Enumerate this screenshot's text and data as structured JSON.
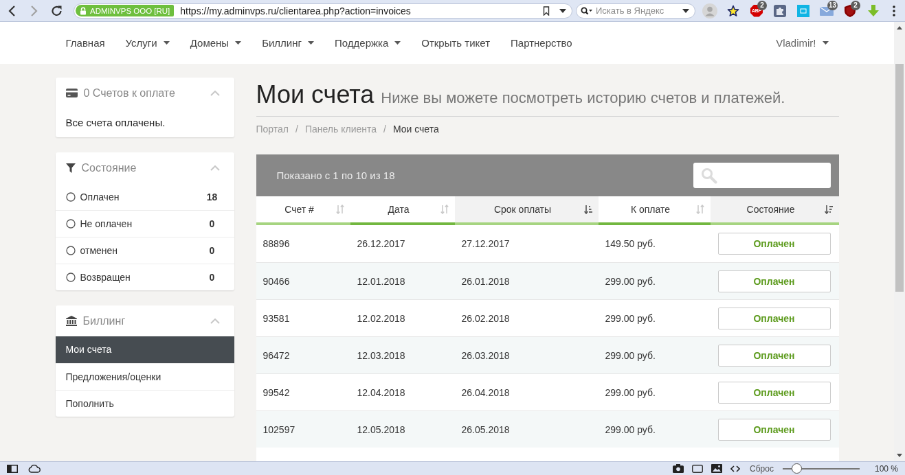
{
  "browser": {
    "nav_buttons": [
      {
        "kind": "back",
        "disabled": false
      },
      {
        "kind": "forward",
        "disabled": true
      },
      {
        "kind": "reload",
        "disabled": false
      }
    ],
    "address_bar": {
      "site_badge": "ADMINVPS OOO [RU]",
      "url": "https://my.adminvps.ru/clientarea.php?action=invoices"
    },
    "search": {
      "placeholder": "Искать в Яндекс"
    },
    "extensions": [
      {
        "kind": "avatar"
      },
      {
        "kind": "star"
      },
      {
        "kind": "octagon",
        "label": "ABP",
        "badge": "2"
      },
      {
        "kind": "puzzle"
      },
      {
        "kind": "tile"
      },
      {
        "kind": "mail",
        "badge": "13"
      },
      {
        "kind": "shield",
        "badge": "2"
      },
      {
        "kind": "download"
      }
    ]
  },
  "nav": {
    "items": [
      {
        "label": "Главная",
        "dropdown": false
      },
      {
        "label": "Услуги",
        "dropdown": true
      },
      {
        "label": "Домены",
        "dropdown": true
      },
      {
        "label": "Биллинг",
        "dropdown": true
      },
      {
        "label": "Поддержка",
        "dropdown": true
      },
      {
        "label": "Открыть тикет",
        "dropdown": false
      },
      {
        "label": "Партнерство",
        "dropdown": false
      }
    ],
    "user": {
      "label": "Vladimir!",
      "dropdown": true
    }
  },
  "sidebar": {
    "panels": [
      {
        "kind": "card",
        "title": "0 Счетов к оплате",
        "expanded": true,
        "text": "Все счета оплачены."
      },
      {
        "kind": "filter",
        "title": "Состояние",
        "expanded": true,
        "filters": [
          {
            "label": "Оплачен",
            "count": "18",
            "selected": false
          },
          {
            "label": "Не оплачен",
            "count": "0",
            "selected": false
          },
          {
            "label": "отменен",
            "count": "0",
            "selected": false
          },
          {
            "label": "Возвращен",
            "count": "0",
            "selected": false
          }
        ]
      },
      {
        "kind": "bank",
        "title": "Биллинг",
        "expanded": true,
        "links": [
          {
            "label": "Мои счета",
            "selected": true
          },
          {
            "label": "Предложения/оценки",
            "selected": false
          },
          {
            "label": "Пополнить",
            "selected": false
          }
        ]
      }
    ]
  },
  "page": {
    "title": "Мои счета",
    "subtitle": "Ниже вы можете посмотреть историю счетов и платежей.",
    "breadcrumb": {
      "items": [
        {
          "label": "Портал",
          "current": false
        },
        {
          "label": "Панель клиента",
          "current": false
        },
        {
          "label": "Мои счета",
          "current": true
        }
      ],
      "separators": [
        "/",
        "/"
      ]
    }
  },
  "table": {
    "summary": "Показано с 1 по 10 из 18",
    "columns": [
      {
        "label": "Счет #",
        "sorted": false
      },
      {
        "label": "Дата",
        "sorted": false
      },
      {
        "label": "Срок оплаты",
        "sorted": true,
        "descending": false
      },
      {
        "label": "К оплате",
        "sorted": false
      },
      {
        "label": "Состояние",
        "sorted": true,
        "descending": true
      }
    ],
    "rows": [
      {
        "number": "88896",
        "date": "26.12.2017",
        "due": "27.12.2017",
        "total": "149.50 руб.",
        "status": "Оплачен"
      },
      {
        "number": "90466",
        "date": "12.01.2018",
        "due": "26.01.2018",
        "total": "299.00 руб.",
        "status": "Оплачен"
      },
      {
        "number": "93581",
        "date": "12.02.2018",
        "due": "26.02.2018",
        "total": "299.00 руб.",
        "status": "Оплачен"
      },
      {
        "number": "96472",
        "date": "12.03.2018",
        "due": "26.03.2018",
        "total": "299.00 руб.",
        "status": "Оплачен"
      },
      {
        "number": "99542",
        "date": "12.04.2018",
        "due": "26.04.2018",
        "total": "299.00 руб.",
        "status": "Оплачен"
      },
      {
        "number": "102597",
        "date": "12.05.2018",
        "due": "26.05.2018",
        "total": "299.00 руб.",
        "status": "Оплачен"
      }
    ]
  },
  "status_bar": {
    "reset_label": "Сброс",
    "zoom": {
      "level": 0.13
    },
    "zoom_label": "100 %"
  }
}
